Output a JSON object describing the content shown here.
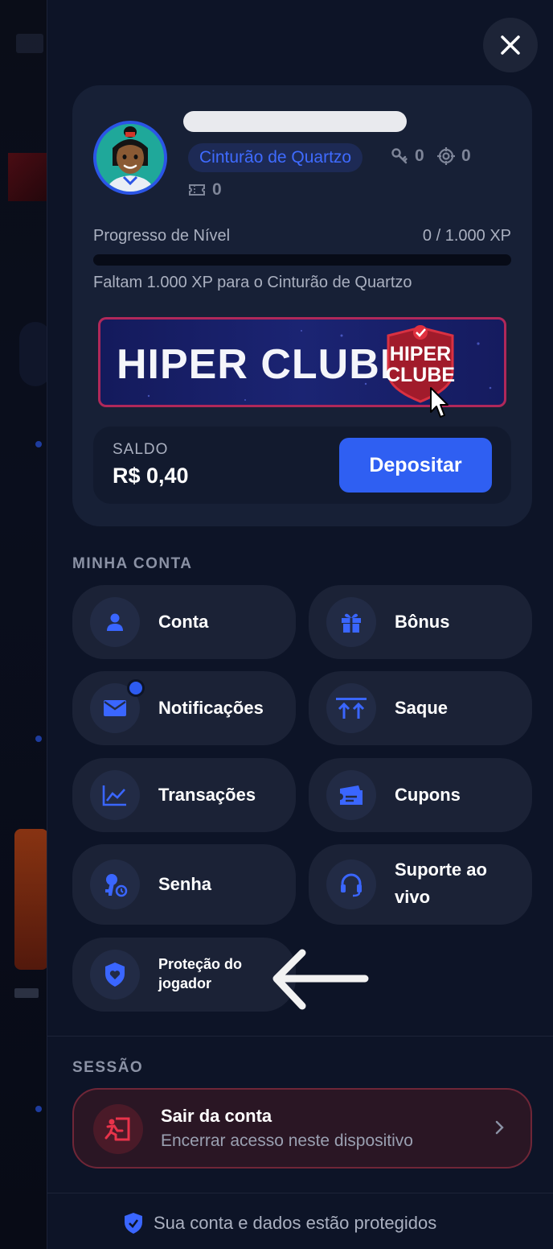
{
  "drawer": {
    "close_icon": "close-icon",
    "profile": {
      "rank": "Cinturão de Quartzo",
      "keys": "0",
      "targets": "0",
      "tickets": "0",
      "progress_label": "Progresso de Nível",
      "progress_value": "0 / 1.000 XP",
      "progress_fraction": 0,
      "progress_hint": "Faltam 1.000 XP para o Cinturão de Quartzo",
      "banner_title": "HIPER CLUBE",
      "banner_logo_line1": "HIPER",
      "banner_logo_line2": "CLUBE",
      "balance_label": "SALDO",
      "balance_value": "R$ 0,40",
      "deposit_label": "Depositar"
    },
    "account_section": {
      "title": "MINHA CONTA",
      "items": [
        {
          "label": "Conta",
          "icon": "user-icon"
        },
        {
          "label": "Bônus",
          "icon": "gift-icon"
        },
        {
          "label": "Notificações",
          "icon": "mail-icon"
        },
        {
          "label": "Saque",
          "icon": "withdraw-icon"
        },
        {
          "label": "Transações",
          "icon": "chart-icon"
        },
        {
          "label": "Cupons",
          "icon": "ticket-icon"
        },
        {
          "label": "Senha",
          "icon": "key-icon"
        },
        {
          "label": "Suporte ao vivo",
          "icon": "headset-icon"
        },
        {
          "label": "Proteção do jogador",
          "icon": "shield-heart-icon"
        }
      ]
    },
    "session_section": {
      "title": "SESSÃO",
      "logout_title": "Sair da conta",
      "logout_subtitle": "Encerrar acesso neste dispositivo"
    },
    "footer_text": "Sua conta e dados estão protegidos",
    "colors": {
      "accent": "#2f5ff2",
      "panel": "#0d1427",
      "card": "#172036",
      "danger": "#e8334a"
    }
  }
}
